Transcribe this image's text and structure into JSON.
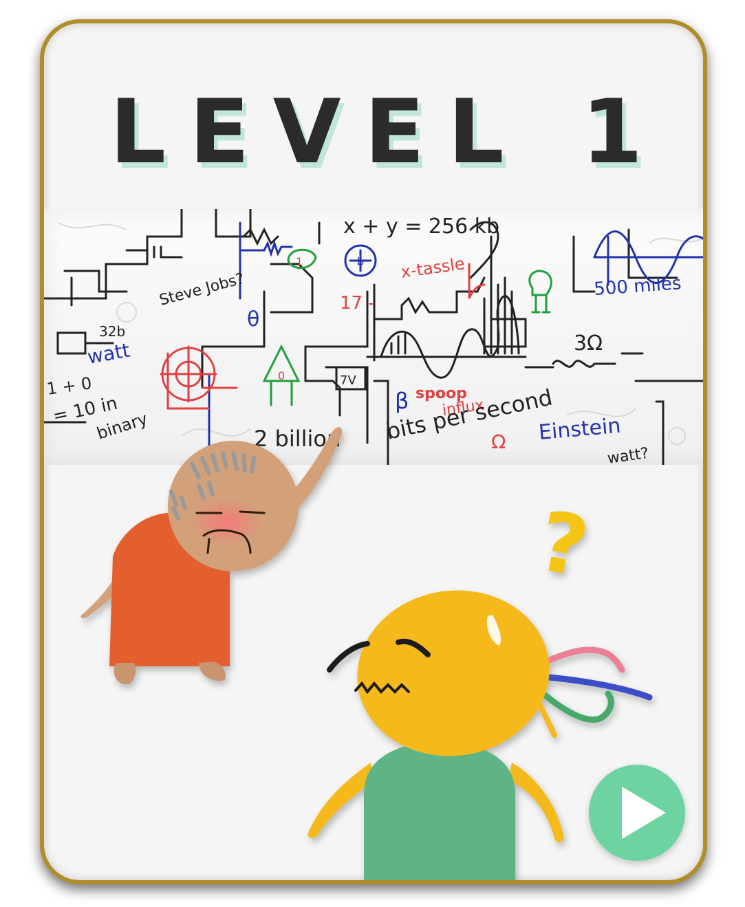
{
  "level": {
    "title": "LEVEL 1"
  },
  "whiteboard": {
    "scribbles": {
      "equation": "x + y = 256 kb",
      "x_tassle": "x-tassle",
      "steve_jobs": "Steve Jobs?",
      "seventeen": "17 -",
      "theta": "θ",
      "five_hundred_miles": "500 miles",
      "three_ohm": "3Ω",
      "thirty_two_b": "32b",
      "watt": "watt",
      "one_plus_zero": "1 + 0",
      "ten_in_binary": "= 10 in",
      "binary": "binary",
      "seven_v": "7V",
      "beta": "β",
      "spoop": "spoop",
      "influx": "influx",
      "bits_per_second": "bits per second",
      "two_billion": "2 billion",
      "omega": "Ω",
      "einstein": "Einstein",
      "watt_question": "watt?",
      "gate_one": "1",
      "gate_zero": "0",
      "gate_b": "b"
    }
  },
  "characters": {
    "teacher": "old-professor",
    "student": "confused-student",
    "question_mark": "?"
  },
  "colors": {
    "frame_gold": "#b08d2a",
    "title_shadow": "#bfe6d6",
    "teacher_robe": "#e35f2f",
    "teacher_skin": "#d2a17a",
    "student_head": "#f5b91e",
    "student_body": "#5fb486",
    "play_button": "#6dd3a0",
    "question_mark": "#f5c518"
  },
  "controls": {
    "play_icon": "play-icon"
  }
}
